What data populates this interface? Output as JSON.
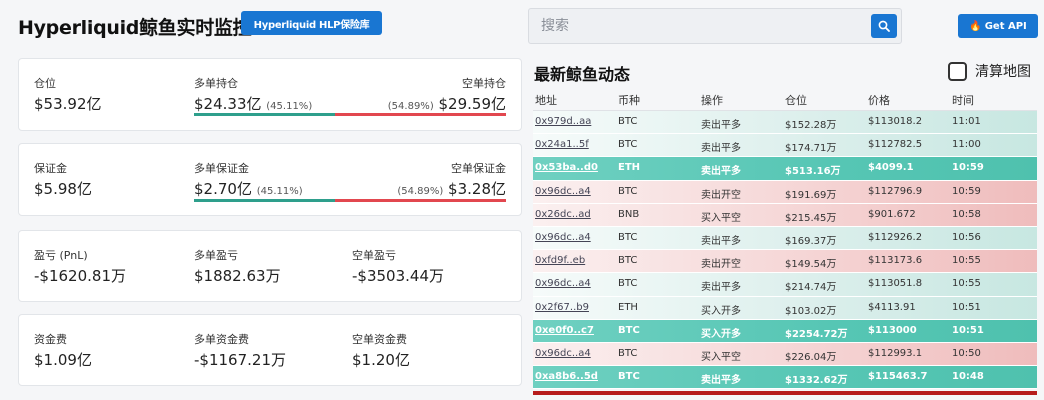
{
  "header": {
    "title": "Hyperliquid鲸鱼实时监控",
    "hlp_button": "Hyperliquid HLP保险库",
    "search_placeholder": "搜索",
    "api_button": "Get API"
  },
  "cards": {
    "position": {
      "total_label": "仓位",
      "total_value": "$53.92亿",
      "long_label": "多单持仓",
      "long_value": "$24.33亿",
      "long_pct": "(45.11%)",
      "short_label": "空单持仓",
      "short_value": "$29.59亿",
      "short_pct": "(54.89%)",
      "long_share": 0.4511
    },
    "margin": {
      "total_label": "保证金",
      "total_value": "$5.98亿",
      "long_label": "多单保证金",
      "long_value": "$2.70亿",
      "long_pct": "(45.11%)",
      "short_label": "空单保证金",
      "short_value": "$3.28亿",
      "short_pct": "(54.89%)",
      "long_share": 0.4511
    },
    "pnl": {
      "total_label": "盈亏 (PnL)",
      "total_value": "-$1620.81万",
      "long_label": "多单盈亏",
      "long_value": "$1882.63万",
      "short_label": "空单盈亏",
      "short_value": "-$3503.44万"
    },
    "funding": {
      "total_label": "资金费",
      "total_value": "$1.09亿",
      "long_label": "多单资金费",
      "long_value": "-$1167.21万",
      "short_label": "空单资金费",
      "short_value": "$1.20亿"
    }
  },
  "feed": {
    "title": "最新鲸鱼动态",
    "clear_map": "清算地图",
    "columns": [
      "地址",
      "币种",
      "操作",
      "仓位",
      "价格",
      "时间"
    ],
    "rows": [
      {
        "addr": "0x979d..aa",
        "coin": "BTC",
        "op": "卖出平多",
        "size": "$152.28万",
        "price": "$113018.2",
        "time": "11:01",
        "style": "long-light"
      },
      {
        "addr": "0x24a1..5f",
        "coin": "BTC",
        "op": "卖出平多",
        "size": "$174.71万",
        "price": "$112782.5",
        "time": "11:00",
        "style": "long-light"
      },
      {
        "addr": "0x53ba..d0",
        "coin": "ETH",
        "op": "卖出平多",
        "size": "$513.16万",
        "price": "$4099.1",
        "time": "10:59",
        "style": "long-strong"
      },
      {
        "addr": "0x96dc..a4",
        "coin": "BTC",
        "op": "卖出开空",
        "size": "$191.69万",
        "price": "$112796.9",
        "time": "10:59",
        "style": "short-light"
      },
      {
        "addr": "0x26dc..ad",
        "coin": "BNB",
        "op": "买入平空",
        "size": "$215.45万",
        "price": "$901.672",
        "time": "10:58",
        "style": "short-light"
      },
      {
        "addr": "0x96dc..a4",
        "coin": "BTC",
        "op": "卖出平多",
        "size": "$169.37万",
        "price": "$112926.2",
        "time": "10:56",
        "style": "long-light"
      },
      {
        "addr": "0xfd9f..eb",
        "coin": "BTC",
        "op": "卖出开空",
        "size": "$149.54万",
        "price": "$113173.6",
        "time": "10:55",
        "style": "short-light"
      },
      {
        "addr": "0x96dc..a4",
        "coin": "BTC",
        "op": "卖出平多",
        "size": "$214.74万",
        "price": "$113051.8",
        "time": "10:55",
        "style": "long-light"
      },
      {
        "addr": "0x2f67..b9",
        "coin": "ETH",
        "op": "买入开多",
        "size": "$103.02万",
        "price": "$4113.91",
        "time": "10:51",
        "style": "long-light"
      },
      {
        "addr": "0xe0f0..c7",
        "coin": "BTC",
        "op": "买入开多",
        "size": "$2254.72万",
        "price": "$113000",
        "time": "10:51",
        "style": "long-strong"
      },
      {
        "addr": "0x96dc..a4",
        "coin": "BTC",
        "op": "买入平空",
        "size": "$226.04万",
        "price": "$112993.1",
        "time": "10:50",
        "style": "short-light"
      },
      {
        "addr": "0xa8b6..5d",
        "coin": "BTC",
        "op": "卖出平多",
        "size": "$1332.62万",
        "price": "$115463.7",
        "time": "10:48",
        "style": "long-strong"
      }
    ]
  },
  "colors": {
    "accent": "#1976d2",
    "long": "#2e9f8c",
    "short": "#e2474f"
  }
}
